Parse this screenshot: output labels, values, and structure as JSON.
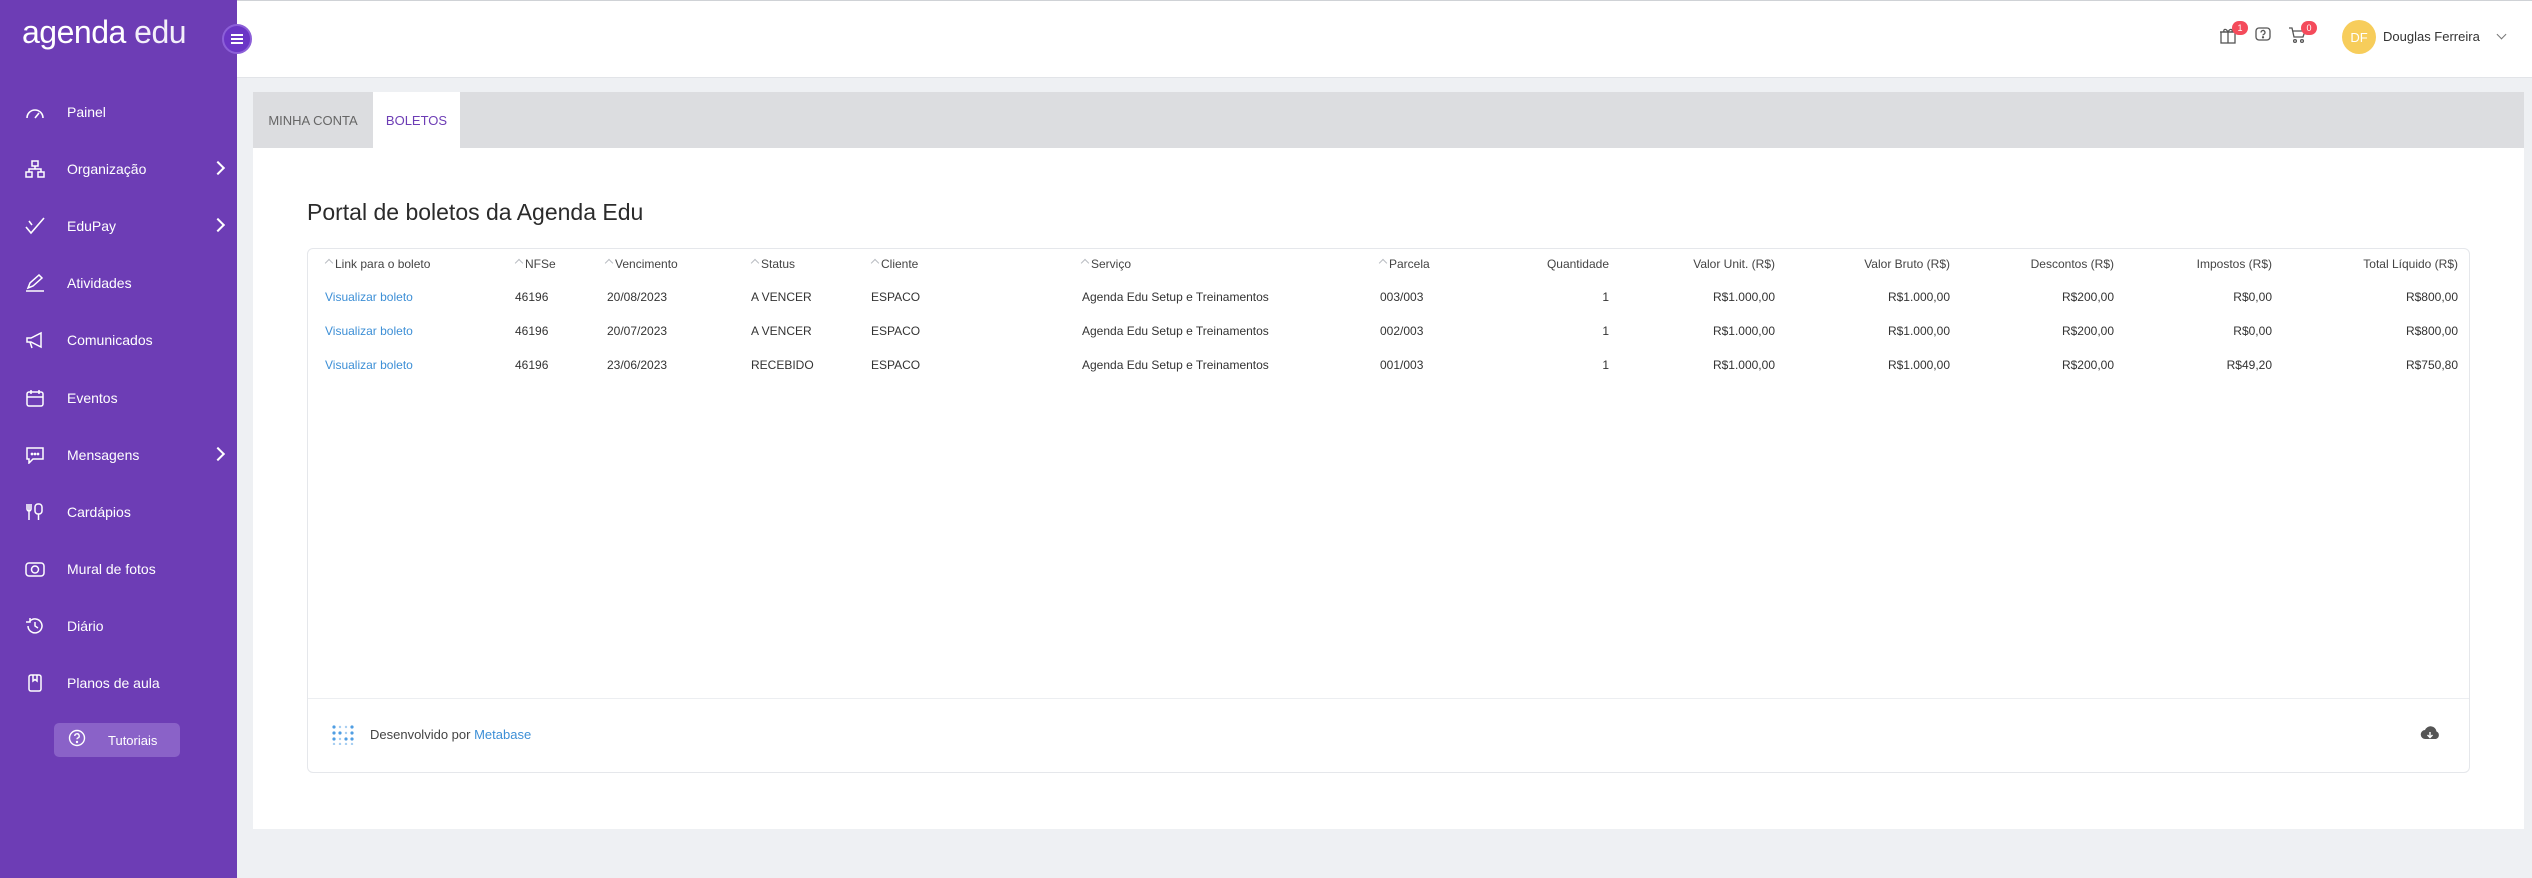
{
  "brand": {
    "part1": "agenda",
    "part2": "edu"
  },
  "sidebar": {
    "items": [
      {
        "label": "Painel",
        "icon": "gauge-icon"
      },
      {
        "label": "Organização",
        "icon": "org-chart-icon",
        "submenu": true
      },
      {
        "label": "EduPay",
        "icon": "check-pay-icon",
        "submenu": true
      },
      {
        "label": "Atividades",
        "icon": "pencil-icon"
      },
      {
        "label": "Comunicados",
        "icon": "megaphone-icon"
      },
      {
        "label": "Eventos",
        "icon": "calendar-icon"
      },
      {
        "label": "Mensagens",
        "icon": "chat-icon",
        "submenu": true
      },
      {
        "label": "Cardápios",
        "icon": "utensils-icon"
      },
      {
        "label": "Mural de fotos",
        "icon": "camera-icon"
      },
      {
        "label": "Diário",
        "icon": "diary-icon"
      },
      {
        "label": "Planos de aula",
        "icon": "book-icon"
      }
    ],
    "tutorials_label": "Tutoriais"
  },
  "header": {
    "badges": {
      "gift": "1",
      "cart": "0"
    },
    "user_initials": "DF",
    "user_name": "Douglas Ferreira"
  },
  "tabs": [
    {
      "label": "MINHA CONTA",
      "active": false
    },
    {
      "label": "BOLETOS",
      "active": true
    }
  ],
  "page_title": "Portal de boletos da Agenda Edu",
  "table": {
    "columns": [
      "Link para o boleto",
      "NFSe",
      "Vencimento",
      "Status",
      "Cliente",
      "Serviço",
      "Parcela",
      "Quantidade",
      "Valor Unit. (R$)",
      "Valor Bruto (R$)",
      "Descontos (R$)",
      "Impostos (R$)",
      "Total Líquido (R$)"
    ],
    "rows": [
      [
        "Visualizar boleto",
        "46196",
        "20/08/2023",
        "A VENCER",
        "ESPACO",
        "Agenda Edu Setup e Treinamentos",
        "003/003",
        "1",
        "R$1.000,00",
        "R$1.000,00",
        "R$200,00",
        "R$0,00",
        "R$800,00"
      ],
      [
        "Visualizar boleto",
        "46196",
        "20/07/2023",
        "A VENCER",
        "ESPACO",
        "Agenda Edu Setup e Treinamentos",
        "002/003",
        "1",
        "R$1.000,00",
        "R$1.000,00",
        "R$200,00",
        "R$0,00",
        "R$800,00"
      ],
      [
        "Visualizar boleto",
        "46196",
        "23/06/2023",
        "RECEBIDO",
        "ESPACO",
        "Agenda Edu Setup e Treinamentos",
        "001/003",
        "1",
        "R$1.000,00",
        "R$1.000,00",
        "R$200,00",
        "R$49,20",
        "R$750,80"
      ]
    ]
  },
  "footer": {
    "text": "Desenvolvido por",
    "link": "Metabase"
  },
  "colors": {
    "sidebar": "#6d3db5",
    "accent": "#6d3db5",
    "link": "#3d8fd6",
    "badge": "#f44b5b",
    "avatar": "#f7cd5b"
  }
}
